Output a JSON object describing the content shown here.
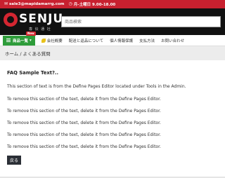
{
  "topbar": {
    "email": "sale3@mapidamarrg.com",
    "hours": "月-土曜日 9.00-18.00"
  },
  "header": {
    "logo_text": "SENJU",
    "logo_sub": "専 伝 通 社",
    "search_placeholder": "商品検索"
  },
  "nav": {
    "category_label": "商品一覧",
    "category_caret": "▾",
    "new_badge": "New",
    "items": [
      "会社概要",
      "配送と返品について",
      "個人情報保護",
      "支払方法",
      "お問い合わせ"
    ]
  },
  "breadcrumb": "ホーム / よくある質問",
  "content": {
    "title": "FAQ Sample Text?..",
    "intro": "This section of text is from the Define Pages Editor located under Tools in the Admin.",
    "paragraphs": [
      "To remove this section of the text, delete it from the Define Pages Editor.",
      "To remove this section of the text, delete it from the Define Pages Editor.",
      "To remove this section of the text, delete it from the Define Pages Editor.",
      "To remove this section of the text, delete it from the Define Pages Editor.",
      "To remove this section of the text, delete it from the Define Pages Editor.",
      "To remove this section of the text, delete it from the Define Pages Editor."
    ],
    "back_label": "戻る"
  },
  "colors": {
    "topbar": "#c8202f",
    "header": "#111111",
    "category_button": "#2e9c3a",
    "back_button": "#2b2f36"
  }
}
